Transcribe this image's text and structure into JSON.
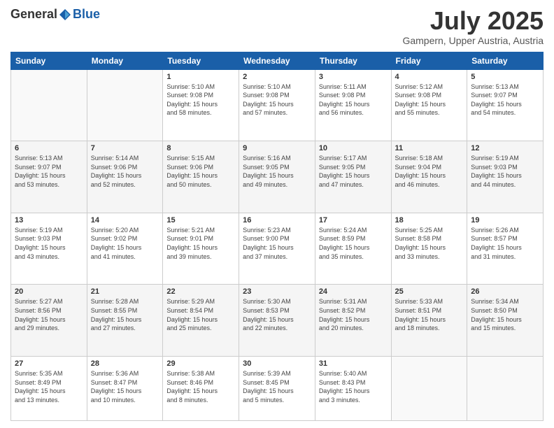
{
  "header": {
    "logo_general": "General",
    "logo_blue": "Blue",
    "month": "July 2025",
    "location": "Gampern, Upper Austria, Austria"
  },
  "days_of_week": [
    "Sunday",
    "Monday",
    "Tuesday",
    "Wednesday",
    "Thursday",
    "Friday",
    "Saturday"
  ],
  "weeks": [
    [
      {
        "day": "",
        "info": ""
      },
      {
        "day": "",
        "info": ""
      },
      {
        "day": "1",
        "info": "Sunrise: 5:10 AM\nSunset: 9:08 PM\nDaylight: 15 hours\nand 58 minutes."
      },
      {
        "day": "2",
        "info": "Sunrise: 5:10 AM\nSunset: 9:08 PM\nDaylight: 15 hours\nand 57 minutes."
      },
      {
        "day": "3",
        "info": "Sunrise: 5:11 AM\nSunset: 9:08 PM\nDaylight: 15 hours\nand 56 minutes."
      },
      {
        "day": "4",
        "info": "Sunrise: 5:12 AM\nSunset: 9:08 PM\nDaylight: 15 hours\nand 55 minutes."
      },
      {
        "day": "5",
        "info": "Sunrise: 5:13 AM\nSunset: 9:07 PM\nDaylight: 15 hours\nand 54 minutes."
      }
    ],
    [
      {
        "day": "6",
        "info": "Sunrise: 5:13 AM\nSunset: 9:07 PM\nDaylight: 15 hours\nand 53 minutes."
      },
      {
        "day": "7",
        "info": "Sunrise: 5:14 AM\nSunset: 9:06 PM\nDaylight: 15 hours\nand 52 minutes."
      },
      {
        "day": "8",
        "info": "Sunrise: 5:15 AM\nSunset: 9:06 PM\nDaylight: 15 hours\nand 50 minutes."
      },
      {
        "day": "9",
        "info": "Sunrise: 5:16 AM\nSunset: 9:05 PM\nDaylight: 15 hours\nand 49 minutes."
      },
      {
        "day": "10",
        "info": "Sunrise: 5:17 AM\nSunset: 9:05 PM\nDaylight: 15 hours\nand 47 minutes."
      },
      {
        "day": "11",
        "info": "Sunrise: 5:18 AM\nSunset: 9:04 PM\nDaylight: 15 hours\nand 46 minutes."
      },
      {
        "day": "12",
        "info": "Sunrise: 5:19 AM\nSunset: 9:03 PM\nDaylight: 15 hours\nand 44 minutes."
      }
    ],
    [
      {
        "day": "13",
        "info": "Sunrise: 5:19 AM\nSunset: 9:03 PM\nDaylight: 15 hours\nand 43 minutes."
      },
      {
        "day": "14",
        "info": "Sunrise: 5:20 AM\nSunset: 9:02 PM\nDaylight: 15 hours\nand 41 minutes."
      },
      {
        "day": "15",
        "info": "Sunrise: 5:21 AM\nSunset: 9:01 PM\nDaylight: 15 hours\nand 39 minutes."
      },
      {
        "day": "16",
        "info": "Sunrise: 5:23 AM\nSunset: 9:00 PM\nDaylight: 15 hours\nand 37 minutes."
      },
      {
        "day": "17",
        "info": "Sunrise: 5:24 AM\nSunset: 8:59 PM\nDaylight: 15 hours\nand 35 minutes."
      },
      {
        "day": "18",
        "info": "Sunrise: 5:25 AM\nSunset: 8:58 PM\nDaylight: 15 hours\nand 33 minutes."
      },
      {
        "day": "19",
        "info": "Sunrise: 5:26 AM\nSunset: 8:57 PM\nDaylight: 15 hours\nand 31 minutes."
      }
    ],
    [
      {
        "day": "20",
        "info": "Sunrise: 5:27 AM\nSunset: 8:56 PM\nDaylight: 15 hours\nand 29 minutes."
      },
      {
        "day": "21",
        "info": "Sunrise: 5:28 AM\nSunset: 8:55 PM\nDaylight: 15 hours\nand 27 minutes."
      },
      {
        "day": "22",
        "info": "Sunrise: 5:29 AM\nSunset: 8:54 PM\nDaylight: 15 hours\nand 25 minutes."
      },
      {
        "day": "23",
        "info": "Sunrise: 5:30 AM\nSunset: 8:53 PM\nDaylight: 15 hours\nand 22 minutes."
      },
      {
        "day": "24",
        "info": "Sunrise: 5:31 AM\nSunset: 8:52 PM\nDaylight: 15 hours\nand 20 minutes."
      },
      {
        "day": "25",
        "info": "Sunrise: 5:33 AM\nSunset: 8:51 PM\nDaylight: 15 hours\nand 18 minutes."
      },
      {
        "day": "26",
        "info": "Sunrise: 5:34 AM\nSunset: 8:50 PM\nDaylight: 15 hours\nand 15 minutes."
      }
    ],
    [
      {
        "day": "27",
        "info": "Sunrise: 5:35 AM\nSunset: 8:49 PM\nDaylight: 15 hours\nand 13 minutes."
      },
      {
        "day": "28",
        "info": "Sunrise: 5:36 AM\nSunset: 8:47 PM\nDaylight: 15 hours\nand 10 minutes."
      },
      {
        "day": "29",
        "info": "Sunrise: 5:38 AM\nSunset: 8:46 PM\nDaylight: 15 hours\nand 8 minutes."
      },
      {
        "day": "30",
        "info": "Sunrise: 5:39 AM\nSunset: 8:45 PM\nDaylight: 15 hours\nand 5 minutes."
      },
      {
        "day": "31",
        "info": "Sunrise: 5:40 AM\nSunset: 8:43 PM\nDaylight: 15 hours\nand 3 minutes."
      },
      {
        "day": "",
        "info": ""
      },
      {
        "day": "",
        "info": ""
      }
    ]
  ]
}
